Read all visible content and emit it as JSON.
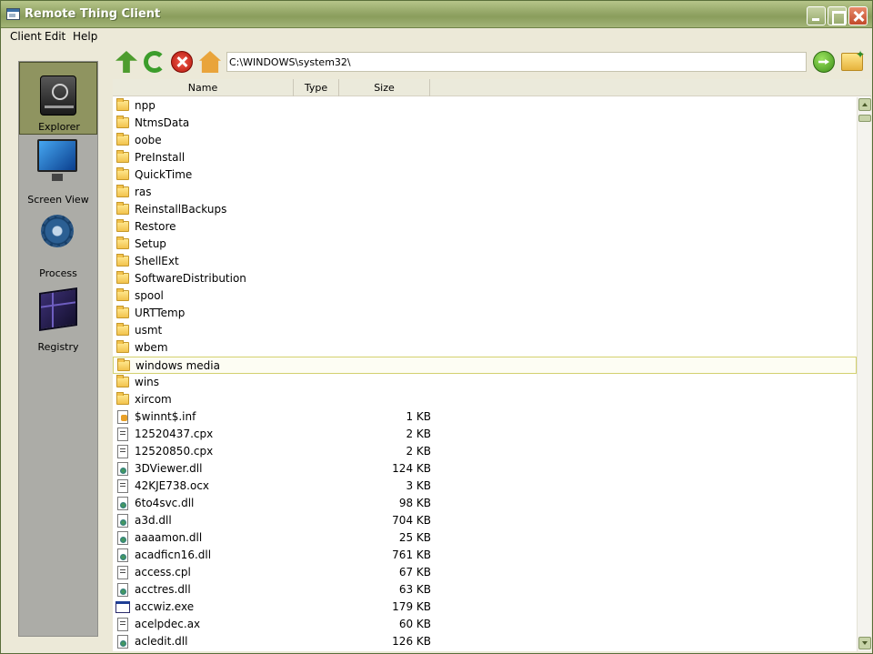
{
  "window": {
    "title": "Remote Thing Client"
  },
  "menu": {
    "items": [
      "Client",
      "Edit",
      "Help"
    ]
  },
  "sidebar": {
    "items": [
      {
        "label": "Explorer",
        "icon": "drive-icon",
        "active": true
      },
      {
        "label": "Screen View",
        "icon": "monitor-icon",
        "active": false
      },
      {
        "label": "Process",
        "icon": "gear-icon",
        "active": false
      },
      {
        "label": "Registry",
        "icon": "cube-icon",
        "active": false
      }
    ]
  },
  "toolbar": {
    "path": "C:\\WINDOWS\\system32\\",
    "buttons": [
      "up-folder-icon",
      "refresh-icon",
      "stop-icon",
      "home-icon",
      "go-icon",
      "new-folder-icon"
    ]
  },
  "list": {
    "columns": [
      "Name",
      "Type",
      "Size"
    ],
    "selected": "windows media",
    "rows": [
      {
        "name": "npp",
        "kind": "folder",
        "size": ""
      },
      {
        "name": "NtmsData",
        "kind": "folder",
        "size": ""
      },
      {
        "name": "oobe",
        "kind": "folder",
        "size": ""
      },
      {
        "name": "PreInstall",
        "kind": "folder",
        "size": ""
      },
      {
        "name": "QuickTime",
        "kind": "folder",
        "size": ""
      },
      {
        "name": "ras",
        "kind": "folder",
        "size": ""
      },
      {
        "name": "ReinstallBackups",
        "kind": "folder",
        "size": ""
      },
      {
        "name": "Restore",
        "kind": "folder",
        "size": ""
      },
      {
        "name": "Setup",
        "kind": "folder",
        "size": ""
      },
      {
        "name": "ShellExt",
        "kind": "folder",
        "size": ""
      },
      {
        "name": "SoftwareDistribution",
        "kind": "folder",
        "size": ""
      },
      {
        "name": "spool",
        "kind": "folder",
        "size": ""
      },
      {
        "name": "URTTemp",
        "kind": "folder",
        "size": ""
      },
      {
        "name": "usmt",
        "kind": "folder",
        "size": ""
      },
      {
        "name": "wbem",
        "kind": "folder",
        "size": ""
      },
      {
        "name": "windows media",
        "kind": "folder",
        "size": ""
      },
      {
        "name": "wins",
        "kind": "folder",
        "size": ""
      },
      {
        "name": "xircom",
        "kind": "folder",
        "size": ""
      },
      {
        "name": "$winnt$.inf",
        "kind": "inf",
        "size": "1 KB"
      },
      {
        "name": "12520437.cpx",
        "kind": "file",
        "size": "2 KB"
      },
      {
        "name": "12520850.cpx",
        "kind": "file",
        "size": "2 KB"
      },
      {
        "name": "3DViewer.dll",
        "kind": "dll",
        "size": "124 KB"
      },
      {
        "name": "42KJE738.ocx",
        "kind": "file",
        "size": "3 KB"
      },
      {
        "name": "6to4svc.dll",
        "kind": "dll",
        "size": "98 KB"
      },
      {
        "name": "a3d.dll",
        "kind": "dll",
        "size": "704 KB"
      },
      {
        "name": "aaaamon.dll",
        "kind": "dll",
        "size": "25 KB"
      },
      {
        "name": "acadficn16.dll",
        "kind": "dll",
        "size": "761 KB"
      },
      {
        "name": "access.cpl",
        "kind": "file",
        "size": "67 KB"
      },
      {
        "name": "acctres.dll",
        "kind": "dll",
        "size": "63 KB"
      },
      {
        "name": "accwiz.exe",
        "kind": "exe",
        "size": "179 KB"
      },
      {
        "name": "acelpdec.ax",
        "kind": "file",
        "size": "60 KB"
      },
      {
        "name": "acledit.dll",
        "kind": "dll",
        "size": "126 KB"
      }
    ]
  },
  "colors": {
    "titlebar": "#97a96a",
    "sidebar": "#acaca7",
    "sidebar_active": "#8f9460",
    "selected_row_border": "#d3d16f"
  }
}
